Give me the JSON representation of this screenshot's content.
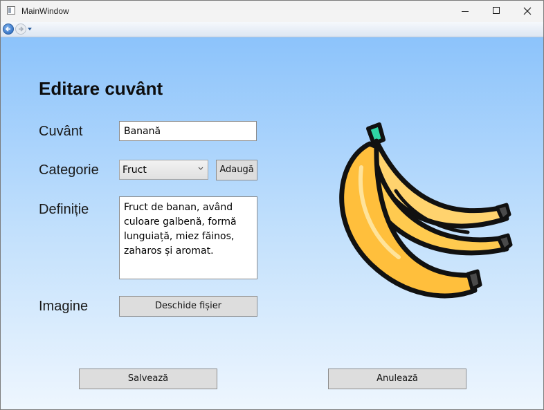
{
  "window": {
    "title": "MainWindow"
  },
  "navigation": {
    "back_icon": "back-arrow-icon",
    "forward_icon": "forward-arrow-icon"
  },
  "form": {
    "heading": "Editare cuvânt",
    "word_label": "Cuvânt",
    "word_value": "Banană",
    "category_label": "Categorie",
    "category_value": "Fruct",
    "add_category_label": "Adaugă",
    "definition_label": "Definiție",
    "definition_value": "Fruct de banan, având culoare galbenă, formă lunguiață, miez făinos, zaharos și aromat.",
    "image_label": "Imagine",
    "open_file_label": "Deschide fișier",
    "image_icon": "banana-image"
  },
  "actions": {
    "save_label": "Salvează",
    "cancel_label": "Anulează"
  },
  "colors": {
    "background_top": "#8cc3fb",
    "background_bottom": "#eef6fe",
    "button": "#dddddd"
  }
}
